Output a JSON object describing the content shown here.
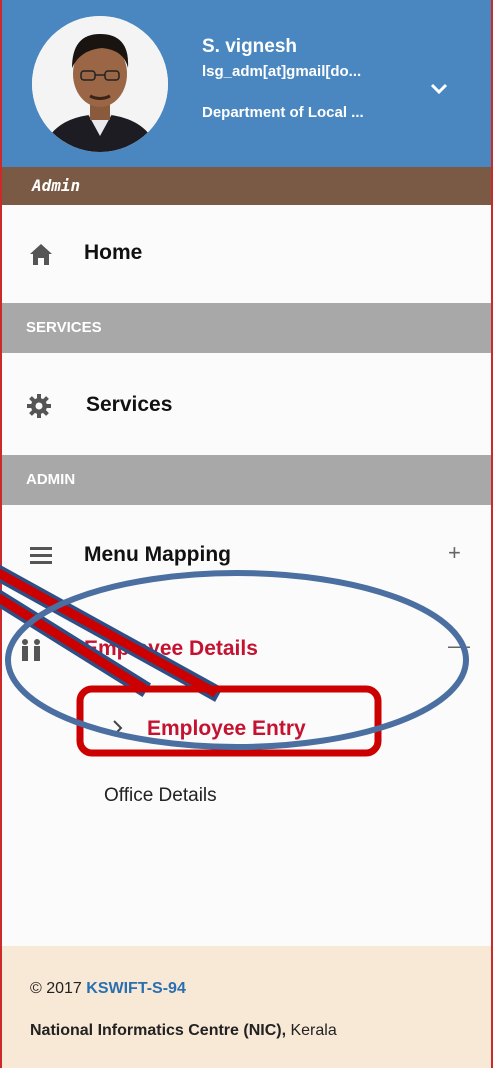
{
  "profile": {
    "name": "S. vignesh",
    "email": "lsg_adm[at]gmail[do...",
    "department": "Department of Local ..."
  },
  "role": "Admin",
  "nav": {
    "home": "Home",
    "services_section": "SERVICES",
    "services": "Services",
    "admin_section": "ADMIN",
    "menu_mapping": "Menu Mapping",
    "menu_mapping_toggle": "+",
    "employee_details": "Employee Details",
    "employee_details_toggle": "—",
    "employee_entry": "Employee Entry",
    "office_details": "Office Details"
  },
  "footer": {
    "copyright_prefix": "© 2017",
    "app_code": "KSWIFT-S-94",
    "org": "National Informatics Centre (NIC),",
    "state": "Kerala"
  },
  "colors": {
    "header_blue": "#4a87c0",
    "role_brown": "#7a5a44",
    "section_gray": "#a8a8a8",
    "active_red": "#c41230",
    "annotation_blue": "#4a6fa0",
    "annotation_red": "#cc0000",
    "footer_bg": "#f8e8d6"
  }
}
